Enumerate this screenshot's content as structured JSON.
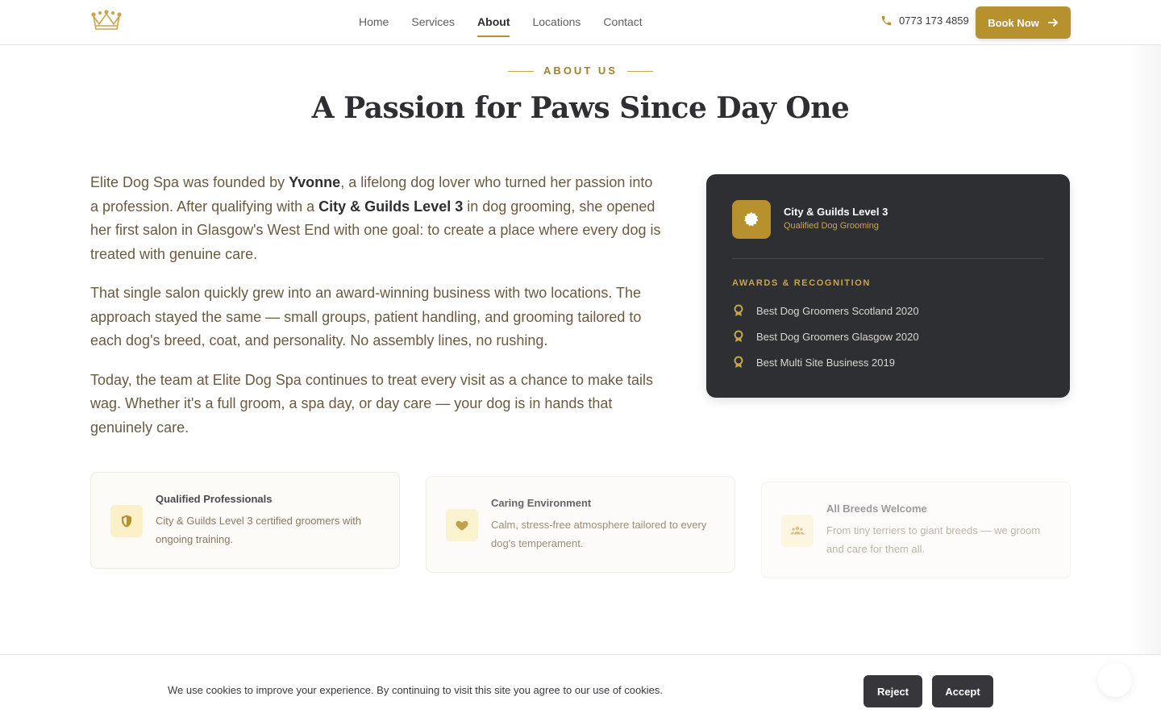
{
  "header": {
    "nav": [
      "Home",
      "Services",
      "About",
      "Locations",
      "Contact"
    ],
    "active_nav": "About",
    "phone": "0773 173 4859",
    "book_label": "Book Now",
    "scroll_progress": 0.41
  },
  "about": {
    "eyebrow": "ABOUT US",
    "title": "A Passion for Paws Since Day One",
    "p1": {
      "a": "Elite Dog Spa was founded by ",
      "b": "Yvonne",
      "c": ", a lifelong dog lover who turned her passion into a profession. After qualifying with a ",
      "d": "City & Guilds Level 3",
      "e": " in dog grooming, she opened her first salon in Glasgow's West End with one goal: to create a place where every dog is treated with genuine care."
    },
    "p2": "That single salon quickly grew into an award-winning business with two locations. The approach stayed the same — small groups, patient handling, and grooming tailored to each dog's breed, coat, and personality. No assembly lines, no rushing.",
    "p3": "Today, the team at Elite Dog Spa continues to treat every visit as a chance to make tails wag. Whether it's a full groom, a spa day, or day care — your dog is in hands that genuinely care."
  },
  "card": {
    "cert_title": "City & Guilds Level 3",
    "cert_sub": "Qualified Dog Grooming",
    "awards_label": "AWARDS & RECOGNITION",
    "awards": [
      "Best Dog Groomers Scotland 2020",
      "Best Dog Groomers Glasgow 2020",
      "Best Multi Site Business 2019"
    ]
  },
  "features": [
    {
      "icon": "shield-icon",
      "title": "Qualified Professionals",
      "desc": "City & Guilds Level 3 certified groomers with ongoing training."
    },
    {
      "icon": "heart-icon",
      "title": "Caring Environment",
      "desc": "Calm, stress-free atmosphere tailored to every dog's temperament."
    },
    {
      "icon": "users-icon",
      "title": "All Breeds Welcome",
      "desc": "From tiny terriers to giant breeds — we groom and care for them all."
    }
  ],
  "cookie": {
    "text": "We use cookies to improve your experience. By continuing to visit this site you agree to our use of cookies.",
    "reject": "Reject",
    "accept": "Accept"
  },
  "colors": {
    "accent": "#b8912f",
    "dark": "#2e2f33",
    "icon_bg": "#fbf0c8"
  }
}
